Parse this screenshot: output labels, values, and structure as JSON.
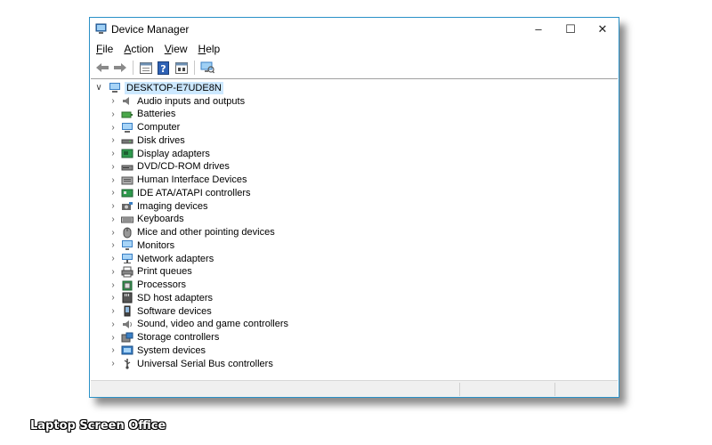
{
  "window": {
    "title": "Device Manager",
    "controls": {
      "minimize": "–",
      "maximize": "☐",
      "close": "✕"
    }
  },
  "menu": [
    {
      "key": "F",
      "rest": "ile"
    },
    {
      "key": "A",
      "rest": "ction"
    },
    {
      "key": "V",
      "rest": "iew"
    },
    {
      "key": "H",
      "rest": "elp"
    }
  ],
  "toolbar": {
    "icons": [
      "back-arrow-icon",
      "forward-arrow-icon",
      "properties-icon",
      "help-icon",
      "view-icon",
      "scan-hardware-icon"
    ]
  },
  "tree": {
    "root_label": "DESKTOP-E7UDE8N",
    "items": [
      {
        "label": "Audio inputs and outputs",
        "icon": "speaker-icon"
      },
      {
        "label": "Batteries",
        "icon": "battery-icon"
      },
      {
        "label": "Computer",
        "icon": "computer-icon"
      },
      {
        "label": "Disk drives",
        "icon": "disk-drive-icon"
      },
      {
        "label": "Display adapters",
        "icon": "display-adapter-icon"
      },
      {
        "label": "DVD/CD-ROM drives",
        "icon": "dvd-drive-icon"
      },
      {
        "label": "Human Interface Devices",
        "icon": "hid-icon"
      },
      {
        "label": "IDE ATA/ATAPI controllers",
        "icon": "ide-controller-icon"
      },
      {
        "label": "Imaging devices",
        "icon": "camera-icon"
      },
      {
        "label": "Keyboards",
        "icon": "keyboard-icon"
      },
      {
        "label": "Mice and other pointing devices",
        "icon": "mouse-icon"
      },
      {
        "label": "Monitors",
        "icon": "monitor-icon"
      },
      {
        "label": "Network adapters",
        "icon": "network-adapter-icon"
      },
      {
        "label": "Print queues",
        "icon": "printer-icon"
      },
      {
        "label": "Processors",
        "icon": "processor-icon"
      },
      {
        "label": "SD host adapters",
        "icon": "sd-card-icon"
      },
      {
        "label": "Software devices",
        "icon": "software-device-icon"
      },
      {
        "label": "Sound, video and game controllers",
        "icon": "sound-controller-icon"
      },
      {
        "label": "Storage controllers",
        "icon": "storage-controller-icon"
      },
      {
        "label": "System devices",
        "icon": "system-device-icon"
      },
      {
        "label": "Universal Serial Bus controllers",
        "icon": "usb-icon"
      }
    ]
  },
  "watermark": "Laptop Screen Office",
  "colors": {
    "window_border": "#2b91c7",
    "selection": "#cce8ff"
  }
}
